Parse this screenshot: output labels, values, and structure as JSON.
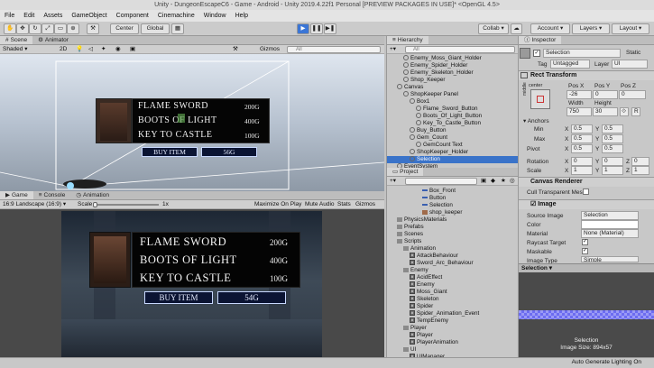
{
  "window": {
    "title": "Unity - DungeonEscapeC6 - Game - Android - Unity 2019.4.22f1 Personal [PREVIEW PACKAGES IN USE]* <OpenGL 4.5>"
  },
  "menu": [
    "File",
    "Edit",
    "Assets",
    "GameObject",
    "Component",
    "Cinemachine",
    "Window",
    "Help"
  ],
  "toolbar": {
    "pivot": "Center",
    "space": "Global",
    "collab": "Collab",
    "account": "Account",
    "layers": "Layers",
    "layout": "Layout"
  },
  "scene": {
    "tabs": [
      "Scene",
      "Animator"
    ],
    "shading": "Shaded",
    "mode2d": "2D",
    "gizmos": "Gizmos",
    "search_placeholder": "All"
  },
  "game": {
    "tabs": [
      "Game",
      "Console",
      "Animation"
    ],
    "aspect": "16:9 Landscape (16:9)",
    "scale_label": "Scale",
    "scale_value": "1x",
    "toggles": [
      "Maximize On Play",
      "Mute Audio",
      "Stats",
      "Gizmos"
    ]
  },
  "shop": {
    "items": [
      {
        "name": "FLAME SWORD",
        "price": "200G"
      },
      {
        "name": "BOOTS OF LIGHT",
        "price": "400G"
      },
      {
        "name": "KEY TO CASTLE",
        "price": "100G"
      }
    ],
    "buy_label": "BUY ITEM",
    "gem_count_scene": "56G",
    "gem_count_game": "54G"
  },
  "hierarchy": {
    "tab": "Hierarchy",
    "search_placeholder": "All",
    "items": [
      {
        "label": "Enemy_Moss_Giant_Holder",
        "indent": 2,
        "icon": "cube"
      },
      {
        "label": "Enemy_Spider_Holder",
        "indent": 2,
        "icon": "cube"
      },
      {
        "label": "Enemy_Skeleton_Holder",
        "indent": 2,
        "icon": "cube"
      },
      {
        "label": "Shop_Keeper",
        "indent": 2,
        "icon": "cube"
      },
      {
        "label": "Canvas",
        "indent": 1,
        "icon": "cube"
      },
      {
        "label": "ShopKeeper Panel",
        "indent": 2,
        "icon": "cube"
      },
      {
        "label": "Box1",
        "indent": 3,
        "icon": "cube"
      },
      {
        "label": "Flame_Sword_Button",
        "indent": 4,
        "icon": "cube"
      },
      {
        "label": "Boots_Of_Light_Button",
        "indent": 4,
        "icon": "cube"
      },
      {
        "label": "Key_To_Castle_Button",
        "indent": 4,
        "icon": "cube"
      },
      {
        "label": "Buy_Button",
        "indent": 3,
        "icon": "cube"
      },
      {
        "label": "Gem_Count",
        "indent": 3,
        "icon": "cube"
      },
      {
        "label": "GemCount Text",
        "indent": 4,
        "icon": "cube"
      },
      {
        "label": "ShopKeeper_Holder",
        "indent": 3,
        "icon": "cube"
      },
      {
        "label": "Selection",
        "indent": 3,
        "icon": "cube",
        "selected": true
      },
      {
        "label": "EventSystem",
        "indent": 1,
        "icon": "cube"
      }
    ]
  },
  "project": {
    "tab": "Project",
    "items": [
      {
        "label": "Box_Front",
        "indent": 5,
        "icon": "line"
      },
      {
        "label": "Button",
        "indent": 5,
        "icon": "line"
      },
      {
        "label": "Selection",
        "indent": 5,
        "icon": "line"
      },
      {
        "label": "shop_keeper",
        "indent": 5,
        "icon": "sprite"
      },
      {
        "label": "PhysicsMaterials",
        "indent": 1,
        "icon": "folder"
      },
      {
        "label": "Prefabs",
        "indent": 1,
        "icon": "folder"
      },
      {
        "label": "Scenes",
        "indent": 1,
        "icon": "folder"
      },
      {
        "label": "Scripts",
        "indent": 1,
        "icon": "folder"
      },
      {
        "label": "Animation",
        "indent": 2,
        "icon": "folder"
      },
      {
        "label": "AttackBehaviour",
        "indent": 3,
        "icon": "script"
      },
      {
        "label": "Sword_Arc_Behaviour",
        "indent": 3,
        "icon": "script"
      },
      {
        "label": "Enemy",
        "indent": 2,
        "icon": "folder"
      },
      {
        "label": "AcidEffect",
        "indent": 3,
        "icon": "script"
      },
      {
        "label": "Enemy",
        "indent": 3,
        "icon": "script"
      },
      {
        "label": "Moss_Giant",
        "indent": 3,
        "icon": "script"
      },
      {
        "label": "Skeleton",
        "indent": 3,
        "icon": "script"
      },
      {
        "label": "Spider",
        "indent": 3,
        "icon": "script"
      },
      {
        "label": "Spider_Animation_Event",
        "indent": 3,
        "icon": "script"
      },
      {
        "label": "TempEnemy",
        "indent": 3,
        "icon": "script"
      },
      {
        "label": "Player",
        "indent": 2,
        "icon": "folder"
      },
      {
        "label": "Player",
        "indent": 3,
        "icon": "script"
      },
      {
        "label": "PlayerAnimation",
        "indent": 3,
        "icon": "script"
      },
      {
        "label": "UI",
        "indent": 2,
        "icon": "folder"
      },
      {
        "label": "UIManager",
        "indent": 3,
        "icon": "script"
      }
    ]
  },
  "inspector": {
    "tab": "Inspector",
    "object_name": "Selection",
    "static_label": "Static",
    "tag_label": "Tag",
    "tag": "Untagged",
    "layer_label": "Layer",
    "layer": "UI",
    "rect": {
      "title": "Rect Transform",
      "anchor_h": "center",
      "anchor_v": "middle",
      "posx_label": "Pos X",
      "posy_label": "Pos Y",
      "posz_label": "Pos Z",
      "posx": "-26",
      "posy": "0",
      "posz": "0",
      "width_label": "Width",
      "height_label": "Height",
      "width": "750",
      "height": "30",
      "r_label": "R",
      "anchors_label": "Anchors",
      "min_label": "Min",
      "max_label": "Max",
      "pivot_label": "Pivot",
      "x_label": "X",
      "y_label": "Y",
      "z_label": "Z",
      "min_x": "0.5",
      "min_y": "0.5",
      "max_x": "0.5",
      "max_y": "0.5",
      "pivot_x": "0.5",
      "pivot_y": "0.5",
      "rotation_label": "Rotation",
      "rot_x": "0",
      "rot_y": "0",
      "rot_z": "0",
      "scale_label": "Scale",
      "scale_x": "1",
      "scale_y": "1",
      "scale_z": "1"
    },
    "canvas_renderer": {
      "title": "Canvas Renderer",
      "cull_label": "Cull Transparent Mes"
    },
    "image": {
      "title": "Image",
      "source_label": "Source Image",
      "source": "Selection",
      "color_label": "Color",
      "material_label": "Material",
      "material": "None (Material)",
      "raycast_label": "Raycast Target",
      "maskable_label": "Maskable",
      "type_label": "Image Type",
      "type": "Simple"
    },
    "preview": {
      "header": "Selection",
      "name": "Selection",
      "size": "Image Size: 894x57"
    }
  },
  "status": {
    "text": "Auto Generate Lighting On"
  }
}
